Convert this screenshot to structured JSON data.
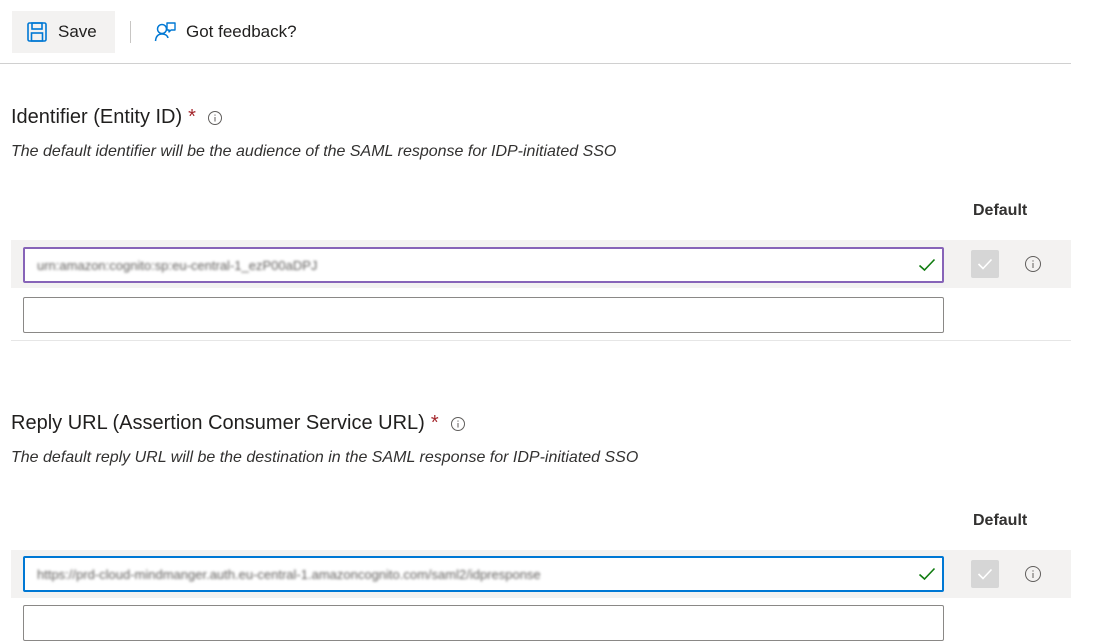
{
  "toolbar": {
    "save_label": "Save",
    "feedback_label": "Got feedback?"
  },
  "identifier": {
    "title": "Identifier (Entity ID)",
    "required_mark": "*",
    "description": "The default identifier will be the audience of the SAML response for IDP-initiated SSO",
    "default_header": "Default",
    "entries": [
      {
        "value": "urn:amazon:cognito:sp:eu-central-1_ezP00aDPJ",
        "is_default": true
      },
      {
        "value": "",
        "is_default": false
      }
    ]
  },
  "reply_url": {
    "title": "Reply URL (Assertion Consumer Service URL)",
    "required_mark": "*",
    "description": "The default reply URL will be the destination in the SAML response for IDP-initiated SSO",
    "default_header": "Default",
    "entries": [
      {
        "value": "https://prd-cloud-mindmanger.auth.eu-central-1.amazoncognito.com/saml2/idpresponse",
        "is_default": true
      },
      {
        "value": "",
        "is_default": false
      }
    ]
  },
  "colors": {
    "accent_blue": "#0078d4",
    "focus_purple": "#8764b8",
    "valid_green": "#107c10",
    "required_red": "#a4262c"
  },
  "icons": {
    "save": "floppy-disk-icon",
    "feedback": "feedback-person-icon",
    "info": "info-circle-icon",
    "valid": "checkmark-icon"
  }
}
